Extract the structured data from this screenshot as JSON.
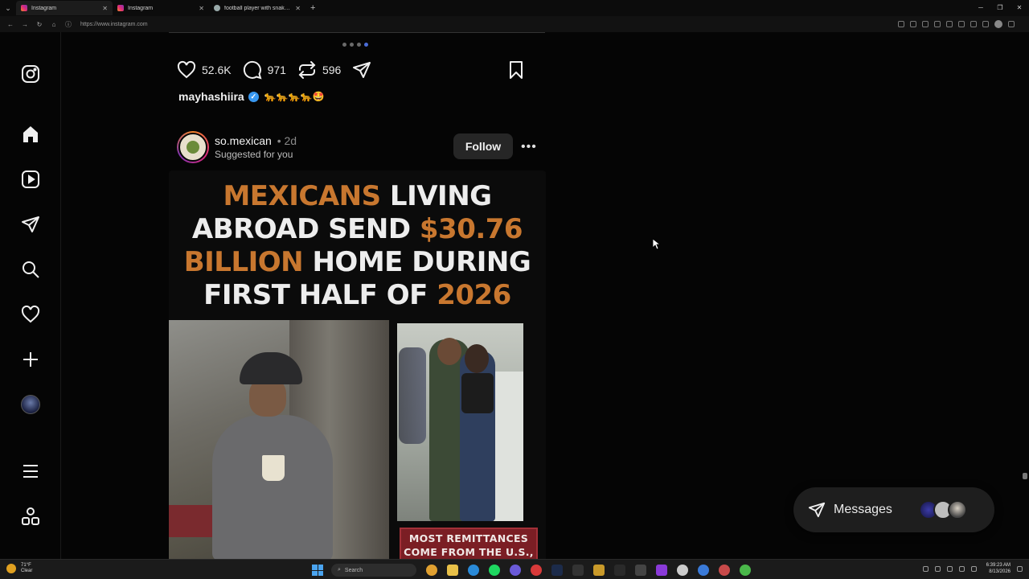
{
  "browser": {
    "tabs": [
      {
        "title": "Instagram",
        "active": true,
        "favicon": "instagram-favicon"
      },
      {
        "title": "Instagram",
        "active": false,
        "favicon": "instagram-favicon"
      },
      {
        "title": "football player with snake in helm",
        "active": false,
        "favicon": "google-favicon"
      }
    ],
    "url": "https://www.instagram.com"
  },
  "post1": {
    "likes": "52.6K",
    "comments": "971",
    "reposts": "596",
    "caption_user": "mayhashiira",
    "caption_text": "🐆🐆🐆🐆🤩"
  },
  "post2": {
    "username": "so.mexican",
    "time": "• 2d",
    "subtitle": "Suggested for you",
    "follow_label": "Follow",
    "more_label": "•••",
    "headline": {
      "w1": "MEXICANS",
      "w2": " LIVING",
      "w3": "ABROAD SEND ",
      "w4": "$30.76",
      "w5": "BILLION",
      "w6": " HOME DURING",
      "w7": "FIRST HALF OF ",
      "w8": "2026"
    },
    "badge_line1": "MOST REMITTANCES",
    "badge_line2": "COME FROM THE U.S.,",
    "accent_color": "#c8772f"
  },
  "messages": {
    "label": "Messages"
  },
  "taskbar": {
    "weather_temp": "71°F",
    "weather_desc": "Clear",
    "search_placeholder": "Search",
    "time": "6:39:23 AM",
    "date": "8/13/2026"
  }
}
